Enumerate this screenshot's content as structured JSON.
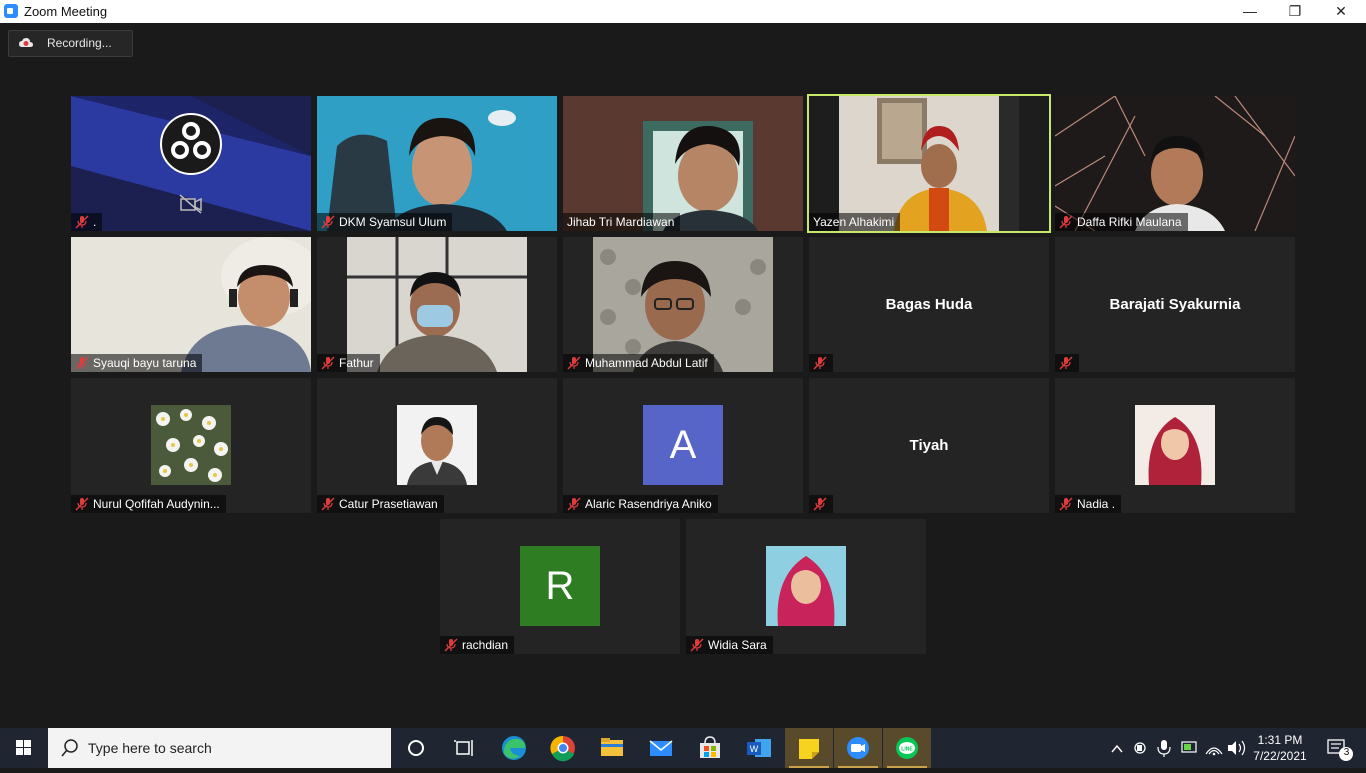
{
  "window": {
    "title": "Zoom Meeting",
    "minimize": "—",
    "restore": "❐",
    "close": "✕"
  },
  "recording": {
    "label": "Recording..."
  },
  "participants": [
    {
      "name": "."
    },
    {
      "name": "DKM Syamsul Ulum"
    },
    {
      "name": "Jihab Tri Mardiawan"
    },
    {
      "name": "Yazen Alhakimi"
    },
    {
      "name": "Daffa Rifki Maulana"
    },
    {
      "name": "Syauqi bayu taruna"
    },
    {
      "name": "Fathur"
    },
    {
      "name": "Muhammad Abdul Latif"
    },
    {
      "name": "",
      "display": "Bagas Huda"
    },
    {
      "name": "",
      "display": "Barajati Syakurnia"
    },
    {
      "name": "Nurul Qofifah Audynin..."
    },
    {
      "name": "Catur Prasetiawan"
    },
    {
      "name": "Alaric Rasendriya Aniko",
      "initial": "A"
    },
    {
      "name": "",
      "display": "Tiyah"
    },
    {
      "name": "Nadia ."
    },
    {
      "name": "rachdian",
      "initial": "R"
    },
    {
      "name": "Widia Sara"
    }
  ],
  "colors": {
    "active_speaker": "#c7e96a",
    "avatar_a": "#5865c8",
    "avatar_r": "#2e7d22",
    "mic_muted": "#e03c3c"
  },
  "taskbar": {
    "search_placeholder": "Type here to search",
    "icons": [
      "windows-start-icon",
      "search-icon",
      "cortana-icon",
      "task-view-icon",
      "edge-icon",
      "chrome-icon",
      "file-explorer-icon",
      "mail-icon",
      "store-icon",
      "word-icon",
      "sticky-notes-icon",
      "zoom-icon",
      "line-icon"
    ],
    "clock_time": "1:31 PM",
    "clock_date": "7/22/2021",
    "notification_count": "3"
  }
}
